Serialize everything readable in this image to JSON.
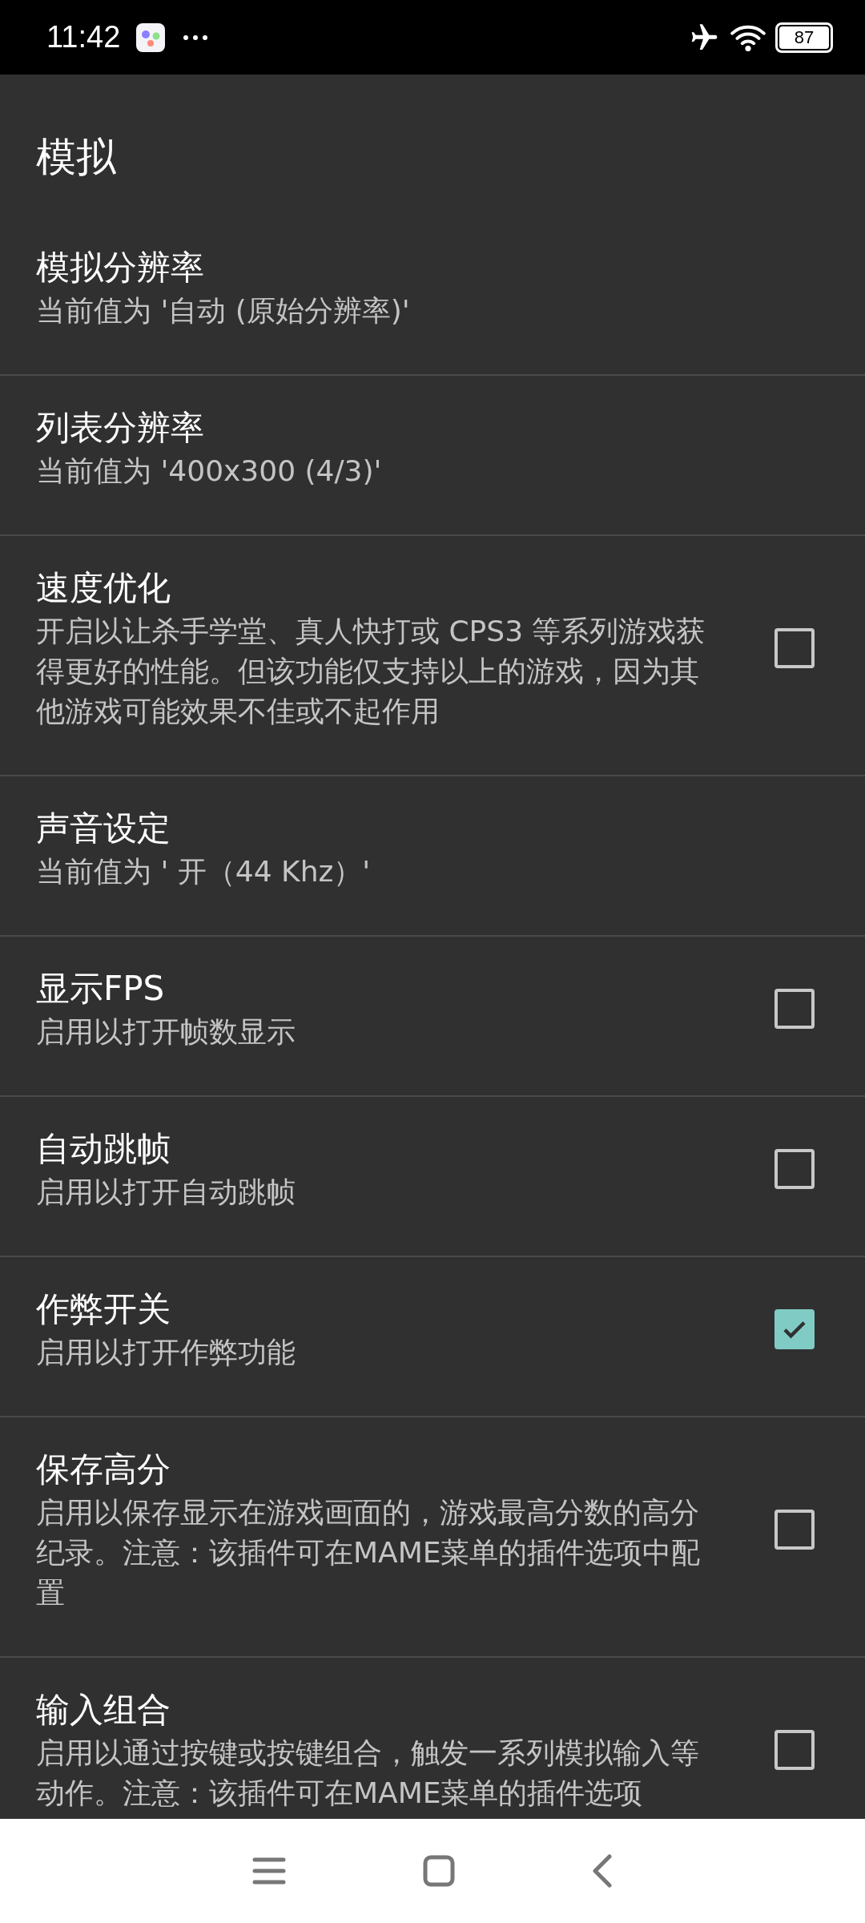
{
  "status_bar": {
    "time": "11:42",
    "battery": "87"
  },
  "header": {
    "title": "模拟"
  },
  "settings": [
    {
      "kind": "value",
      "title": "模拟分辨率",
      "summary": "当前值为 '自动 (原始分辨率)'"
    },
    {
      "kind": "value",
      "title": "列表分辨率",
      "summary": "当前值为 '400x300 (4/3)'"
    },
    {
      "kind": "checkbox",
      "title": "速度优化",
      "summary": "开启以让杀手学堂、真人快打或 CPS3 等系列游戏获得更好的性能。但该功能仅支持以上的游戏，因为其他游戏可能效果不佳或不起作用",
      "checked": false
    },
    {
      "kind": "value",
      "title": "声音设定",
      "summary": "当前值为 ' 开（44 Khz）'"
    },
    {
      "kind": "checkbox",
      "title": "显示FPS",
      "summary": "启用以打开帧数显示",
      "checked": false
    },
    {
      "kind": "checkbox",
      "title": "自动跳帧",
      "summary": "启用以打开自动跳帧",
      "checked": false
    },
    {
      "kind": "checkbox",
      "title": "作弊开关",
      "summary": "启用以打开作弊功能",
      "checked": true
    },
    {
      "kind": "checkbox",
      "title": "保存高分",
      "summary": "启用以保存显示在游戏画面的，游戏最高分数的高分纪录。注意：该插件可在MAME菜单的插件选项中配置",
      "checked": false
    },
    {
      "kind": "checkbox",
      "title": "输入组合",
      "summary": "启用以通过按键或按键组合，触发一系列模拟输入等动作。注意：该插件可在MAME菜单的插件选项",
      "checked": false
    }
  ]
}
